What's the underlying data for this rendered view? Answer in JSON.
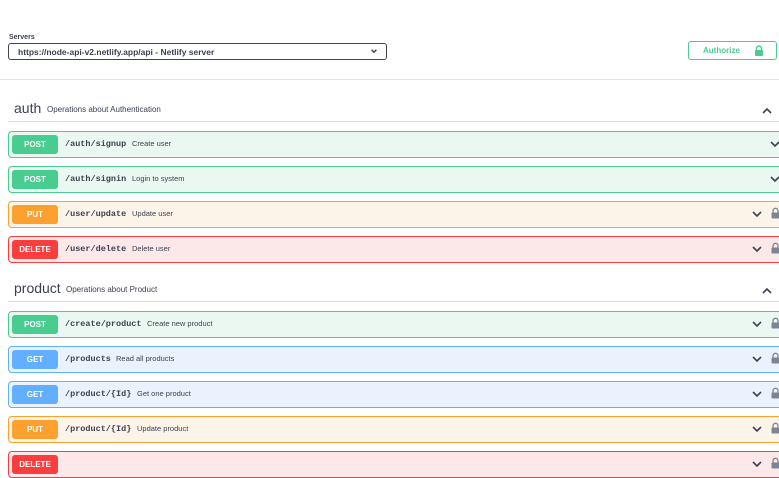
{
  "servers": {
    "label": "Servers",
    "selected": "https://node-api-v2.netlify.app/api - Netlify server"
  },
  "authorize_label": "Authorize",
  "tags": [
    {
      "name": "auth",
      "description": "Operations about Authentication",
      "operations": [
        {
          "method": "POST",
          "path": "/auth/signup",
          "summary": "Create user",
          "locked": false
        },
        {
          "method": "POST",
          "path": "/auth/signin",
          "summary": "Login to system",
          "locked": false
        },
        {
          "method": "PUT",
          "path": "/user/update",
          "summary": "Update user",
          "locked": true
        },
        {
          "method": "DELETE",
          "path": "/user/delete",
          "summary": "Delete user",
          "locked": true
        }
      ]
    },
    {
      "name": "product",
      "description": "Operations about Product",
      "operations": [
        {
          "method": "POST",
          "path": "/create/product",
          "summary": "Create new product",
          "locked": true
        },
        {
          "method": "GET",
          "path": "/products",
          "summary": "Read all products",
          "locked": true
        },
        {
          "method": "GET",
          "path": "/product/{Id}",
          "summary": "Get one product",
          "locked": true
        },
        {
          "method": "PUT",
          "path": "/product/{Id}",
          "summary": "Update product",
          "locked": true
        },
        {
          "method": "DELETE",
          "path": "",
          "summary": "",
          "locked": true
        }
      ]
    }
  ],
  "colors": {
    "post": "#49cc90",
    "put": "#fca130",
    "delete": "#f93e3e",
    "get": "#61affe",
    "text": "#3b4151"
  },
  "icons": {
    "server_select": "chevron-down-icon",
    "authorize": "lock-icon",
    "tag_toggle": "chevron-up-icon",
    "operation_toggle": "chevron-down-icon",
    "operation_auth": "lock-icon"
  }
}
